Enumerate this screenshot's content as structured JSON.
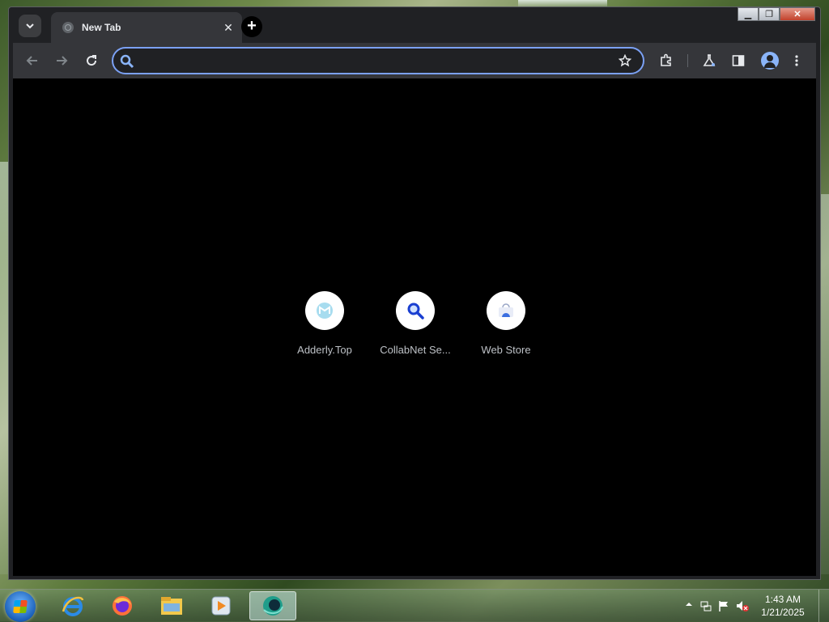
{
  "browser": {
    "tab": {
      "title": "New Tab",
      "close": "✕"
    },
    "new_tab": "+",
    "caption": {
      "minimize": "▁",
      "maximize": "❐",
      "close": "✕"
    },
    "omnibox": {
      "value": "",
      "placeholder": ""
    }
  },
  "shortcuts": [
    {
      "label": "Adderly.Top",
      "icon": "adderly-icon"
    },
    {
      "label": "CollabNet Se...",
      "icon": "magnifier-icon"
    },
    {
      "label": "Web Store",
      "icon": "web-store-icon"
    }
  ],
  "taskbar": {
    "apps": [
      "internet-explorer-icon",
      "firefox-icon",
      "file-explorer-icon",
      "media-player-icon",
      "browser-icon"
    ],
    "clock": {
      "time": "1:43 AM",
      "date": "1/21/2025"
    }
  },
  "colors": {
    "accent": "#7ba1f5",
    "toolbar": "#35363a",
    "frame": "#202124"
  }
}
